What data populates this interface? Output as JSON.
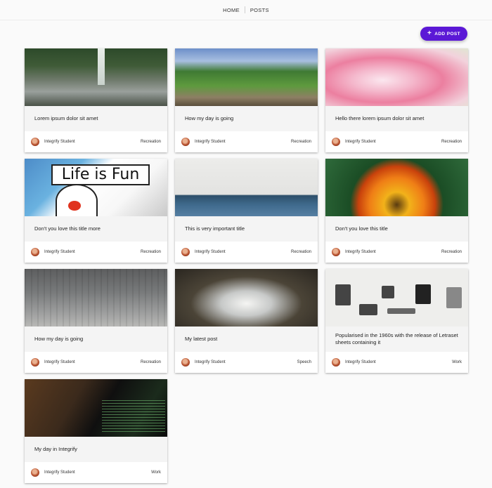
{
  "nav": {
    "home": "HOME",
    "posts": "POSTS"
  },
  "add_button": {
    "icon": "plus-icon",
    "label": "ADD POST",
    "color": "#5b18d6"
  },
  "posts": [
    {
      "title": "Lorem ipsum dolor sit amet",
      "author": "Integrify Student",
      "category": "Recreation",
      "image": "waterfall-photo"
    },
    {
      "title": "How my day is going",
      "author": "Integrify Student",
      "category": "Recreation",
      "image": "forest-river-photo"
    },
    {
      "title": "Hello there lorem ipsum dolor sit amet",
      "author": "Integrify Student",
      "category": "Recreation",
      "image": "pink-dahlia-photo"
    },
    {
      "title": "Don't you love this title more",
      "author": "Integrify Student",
      "category": "Recreation",
      "image": "life-is-fun-cartoon",
      "image_text": "Life is Fun"
    },
    {
      "title": "This is very important title",
      "author": "Integrify Student",
      "category": "Recreation",
      "image": "sea-horizon-photo"
    },
    {
      "title": "Don't you love this title",
      "author": "Integrify Student",
      "category": "Recreation",
      "image": "orange-gerbera-photo"
    },
    {
      "title": "How my day is going",
      "author": "Integrify Student",
      "category": "Recreation",
      "image": "building-wall-photo"
    },
    {
      "title": "My latest post",
      "author": "Integrify Student",
      "category": "Speech",
      "image": "seagull-photo"
    },
    {
      "title": "Popularised in the 1960s with the release of Letraset sheets containing it",
      "author": "Integrify Student",
      "category": "Work",
      "image": "gadgets-flatlay-photo"
    },
    {
      "title": "My day in Integrify",
      "author": "Integrify Student",
      "category": "Work",
      "image": "laptop-code-photo"
    }
  ]
}
